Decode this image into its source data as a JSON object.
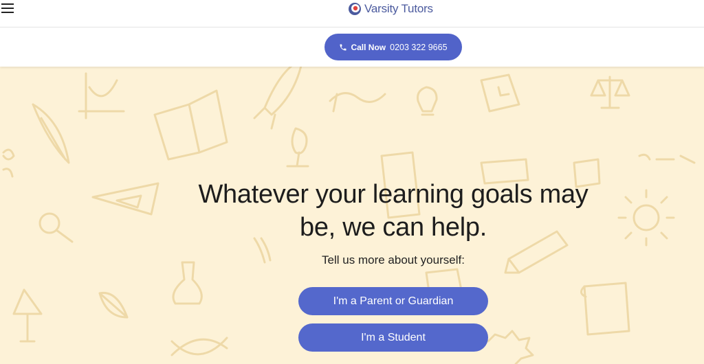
{
  "header": {
    "menu_icon": "hamburger-menu-icon",
    "logo_text": "Varsity Tutors"
  },
  "call_bar": {
    "label": "Call Now",
    "number": "0203 322 9665",
    "icon": "phone-icon"
  },
  "hero": {
    "headline": "Whatever your learning goals may be, we can help.",
    "subhead": "Tell us more about yourself:",
    "buttons": {
      "parent": "I'm a Parent or Guardian",
      "student": "I'm a Student"
    },
    "background_color": "#fdf2d7",
    "doodle_color": "#eed9a8"
  },
  "colors": {
    "brand_blue": "#5468cc",
    "logo_text": "#4b5a9e"
  }
}
